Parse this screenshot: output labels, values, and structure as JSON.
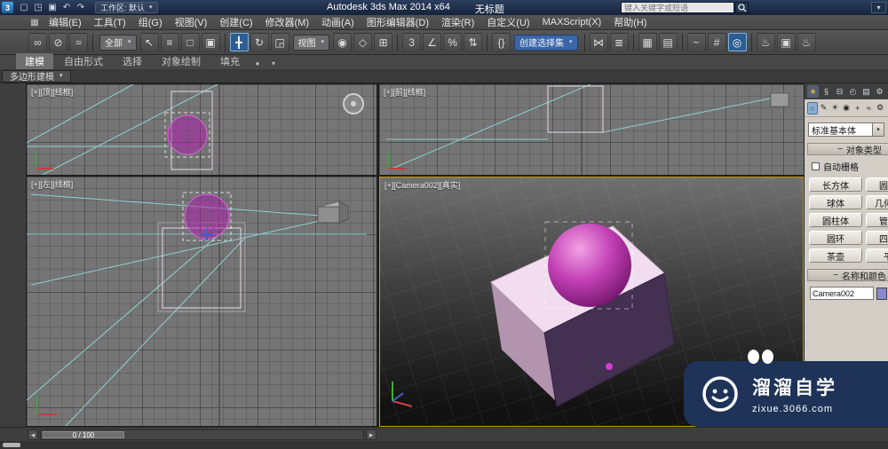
{
  "ui": {
    "caret": "▾"
  },
  "colors": {
    "accent_active": "#2e5d91",
    "viewport_active_border": "#c89600",
    "object_magenta": "#c434c4",
    "object_pink": "#f2ddf0",
    "watermark_bg": "#1e3357"
  },
  "titlebar": {
    "app_initial": "3",
    "quick_access": {
      "new": "▢",
      "open": "◳",
      "save": "▣",
      "undo": "↶",
      "redo": "↷"
    },
    "workspace": "工作区: 默认",
    "title": "Autodesk 3ds Max 2014 x64",
    "doc": "无标题",
    "search_placeholder": "键入关键字或短语",
    "corner_glyph": "▾"
  },
  "menubar": {
    "grid_icon": "▦",
    "items": [
      "编辑(E)",
      "工具(T)",
      "组(G)",
      "视图(V)",
      "创建(C)",
      "修改器(M)",
      "动画(A)",
      "图形编辑器(D)",
      "渲染(R)",
      "自定义(U)",
      "MAXScript(X)",
      "帮助(H)"
    ]
  },
  "toolbar": {
    "filter_dropdown": "全部",
    "coord_dropdown": "视图",
    "named_set_dropdown": "创建选择集",
    "icons": {
      "link": "∞",
      "unlink": "⊘",
      "bind": "≈",
      "select": "↖",
      "byname": "≡",
      "region": "□",
      "window_crossing": "▣",
      "move": "╋",
      "rotate": "↻",
      "scale": "◲",
      "pivot": "◉",
      "manipulate": "◇",
      "keyboard": "⊞",
      "snap3": "3",
      "angle_snap": "∠",
      "percent_snap": "%",
      "spinner_snap": "⇅",
      "named_sets": "{}",
      "mirror": "⋈",
      "align": "≣",
      "layers": "▦",
      "ribbon_toggle": "▤",
      "curve_editor": "~",
      "schematic": "#",
      "material_editor": "◎",
      "render_setup": "♨",
      "rendered_frame": "▣",
      "render_production": "♨"
    }
  },
  "ribbon": {
    "tabs": [
      "建模",
      "自由形式",
      "选择",
      "对象绘制",
      "填充"
    ],
    "more_glyph": "▾",
    "pin_glyph": "●",
    "subtab": "多边形建模"
  },
  "viewports": {
    "top": {
      "label": "[+][顶][线框]"
    },
    "front": {
      "label": "[+][前][线框]"
    },
    "left": {
      "label": "[+][左][线框]"
    },
    "camera": {
      "label": "[+][Camera002][真实]"
    }
  },
  "command_panel": {
    "tabs": {
      "create": "∗",
      "modify": "§",
      "hierarchy": "⊟",
      "motion": "◴",
      "display": "▤",
      "utilities": "⚙"
    },
    "categories": {
      "geometry": "○",
      "shapes": "✎",
      "lights": "☀",
      "cameras": "◉",
      "helpers": "+",
      "space_warps": "≈",
      "systems": "⚙"
    },
    "type_dropdown": "标准基本体",
    "rollout_collapse": "−",
    "object_type_rollout": "对象类型",
    "autogrid_label": "自动栅格",
    "object_buttons": [
      "长方体",
      "圆锥体",
      "球体",
      "几何球体",
      "圆柱体",
      "管状体",
      "圆环",
      "四棱锥",
      "茶壶",
      "平面"
    ],
    "name_color_rollout": "名称和颜色",
    "name_value": "Camera002"
  },
  "timeline": {
    "left_arrow": "◂",
    "right_arrow": "▸",
    "slider_label": "0 / 100"
  },
  "watermark": {
    "brand": "溜溜自学",
    "url": "zixue.3066.com"
  }
}
